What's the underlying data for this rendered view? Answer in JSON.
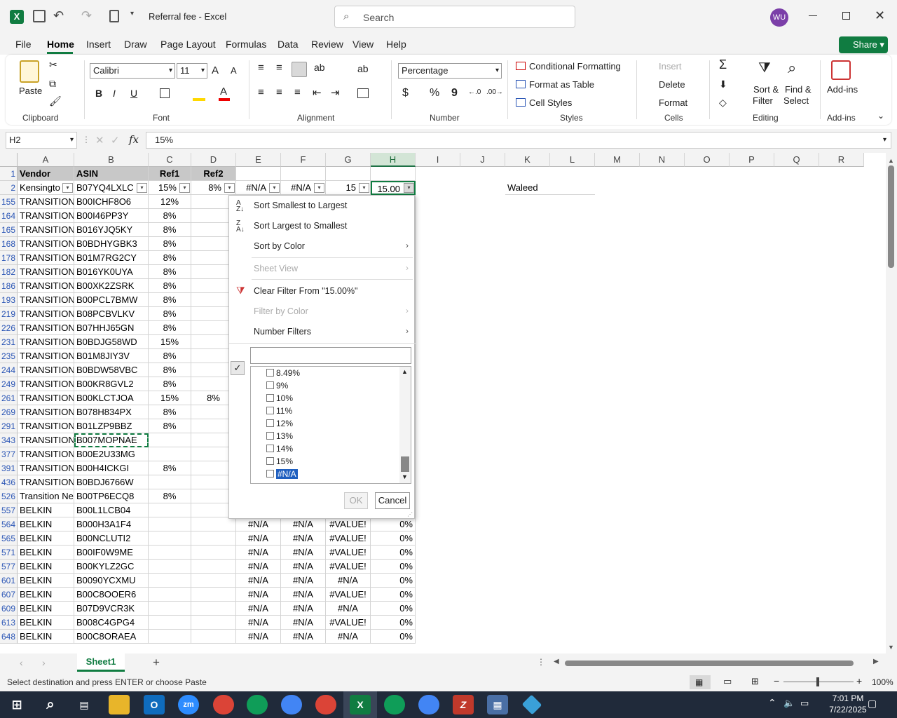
{
  "window": {
    "title": "Referral fee  -  Excel",
    "search_placeholder": "Search",
    "user_initials": "WU"
  },
  "menu": [
    "File",
    "Home",
    "Insert",
    "Draw",
    "Page Layout",
    "Formulas",
    "Data",
    "Review",
    "View",
    "Help"
  ],
  "share_label": "Share",
  "ribbon": {
    "clipboard": {
      "paste": "Paste",
      "label": "Clipboard"
    },
    "font": {
      "name": "Calibri",
      "size": "11",
      "bold": "B",
      "italic": "I",
      "underline": "U",
      "label": "Font"
    },
    "alignment": {
      "label": "Alignment"
    },
    "number": {
      "format": "Percentage",
      "currency": "$",
      "percent": "%",
      "comma": "9",
      "label": "Number"
    },
    "styles": {
      "conditional": "Conditional Formatting",
      "table": "Format as Table",
      "cell_styles": "Cell Styles",
      "label": "Styles"
    },
    "cells": {
      "insert": "Insert",
      "delete": "Delete",
      "format": "Format",
      "label": "Cells"
    },
    "editing": {
      "sum": "Σ",
      "sort": "Sort &",
      "sort2": "Filter",
      "find": "Find &",
      "find2": "Select",
      "label": "Editing"
    },
    "addins": {
      "btn": "Add-ins",
      "label": "Add-ins"
    }
  },
  "formula_bar": {
    "name_box": "H2",
    "fx": "fx",
    "value": "15%"
  },
  "columns": [
    "A",
    "B",
    "C",
    "D",
    "E",
    "F",
    "G",
    "H",
    "I",
    "J",
    "K",
    "L",
    "M",
    "N",
    "O",
    "P",
    "Q",
    "R"
  ],
  "header_row": {
    "num": "1",
    "a": "Vendor",
    "b": "ASIN",
    "c": "Ref1",
    "d": "Ref2"
  },
  "row2": {
    "num": "2",
    "a": "Kensingto",
    "b": "B07YQ4LXLC",
    "c": "15%",
    "d": "8%",
    "e": "#N/A",
    "f": "#N/A",
    "g": "15",
    "h": "15.00",
    "k": "Waleed"
  },
  "rows": [
    {
      "n": "155",
      "a": "TRANSITION",
      "b": "B00ICHF8O6",
      "c": "12%",
      "d": "",
      "e": "",
      "f": "",
      "g": "",
      "h": ""
    },
    {
      "n": "164",
      "a": "TRANSITION",
      "b": "B00I46PP3Y",
      "c": "8%",
      "d": "",
      "e": "",
      "f": "",
      "g": "",
      "h": ""
    },
    {
      "n": "165",
      "a": "TRANSITION",
      "b": "B016YJQ5KY",
      "c": "8%",
      "d": "",
      "e": "",
      "f": "",
      "g": "",
      "h": ""
    },
    {
      "n": "168",
      "a": "TRANSITION",
      "b": "B0BDHYGBK3",
      "c": "8%",
      "d": "",
      "e": "",
      "f": "",
      "g": "",
      "h": ""
    },
    {
      "n": "178",
      "a": "TRANSITION",
      "b": "B01M7RG2CY",
      "c": "8%",
      "d": "",
      "e": "",
      "f": "",
      "g": "",
      "h": ""
    },
    {
      "n": "182",
      "a": "TRANSITION",
      "b": "B016YK0UYA",
      "c": "8%",
      "d": "",
      "e": "",
      "f": "",
      "g": "",
      "h": ""
    },
    {
      "n": "186",
      "a": "TRANSITION",
      "b": "B00XK2ZSRK",
      "c": "8%",
      "d": "",
      "e": "",
      "f": "",
      "g": "",
      "h": ""
    },
    {
      "n": "193",
      "a": "TRANSITION",
      "b": "B00PCL7BMW",
      "c": "8%",
      "d": "",
      "e": "",
      "f": "",
      "g": "",
      "h": ""
    },
    {
      "n": "219",
      "a": "TRANSITION",
      "b": "B08PCBVLKV",
      "c": "8%",
      "d": "",
      "e": "",
      "f": "",
      "g": "",
      "h": ""
    },
    {
      "n": "226",
      "a": "TRANSITION",
      "b": "B07HHJ65GN",
      "c": "8%",
      "d": "",
      "e": "",
      "f": "",
      "g": "",
      "h": ""
    },
    {
      "n": "231",
      "a": "TRANSITION",
      "b": "B0BDJG58WD",
      "c": "15%",
      "d": "",
      "e": "",
      "f": "",
      "g": "",
      "h": ""
    },
    {
      "n": "235",
      "a": "TRANSITION",
      "b": "B01M8JIY3V",
      "c": "8%",
      "d": "",
      "e": "",
      "f": "",
      "g": "",
      "h": ""
    },
    {
      "n": "244",
      "a": "TRANSITION",
      "b": "B0BDW58VBC",
      "c": "8%",
      "d": "",
      "e": "",
      "f": "",
      "g": "",
      "h": ""
    },
    {
      "n": "249",
      "a": "TRANSITION",
      "b": "B00KR8GVL2",
      "c": "8%",
      "d": "",
      "e": "",
      "f": "",
      "g": "",
      "h": ""
    },
    {
      "n": "261",
      "a": "TRANSITION",
      "b": "B00KLCTJOA",
      "c": "15%",
      "d": "8%",
      "e": "",
      "f": "",
      "g": "",
      "h": ""
    },
    {
      "n": "269",
      "a": "TRANSITION",
      "b": "B078H834PX",
      "c": "8%",
      "d": "",
      "e": "",
      "f": "",
      "g": "",
      "h": ""
    },
    {
      "n": "291",
      "a": "TRANSITION",
      "b": "B01LZP9BBZ",
      "c": "8%",
      "d": "",
      "e": "",
      "f": "",
      "g": "",
      "h": ""
    },
    {
      "n": "343",
      "a": "TRANSITION",
      "b": "B007MOPNAE",
      "c": "",
      "d": "",
      "e": "",
      "f": "",
      "g": "",
      "h": ""
    },
    {
      "n": "377",
      "a": "TRANSITION",
      "b": "B00E2U33MG",
      "c": "",
      "d": "",
      "e": "",
      "f": "",
      "g": "",
      "h": ""
    },
    {
      "n": "391",
      "a": "TRANSITION",
      "b": "B00H4ICKGI",
      "c": "8%",
      "d": "",
      "e": "",
      "f": "",
      "g": "",
      "h": ""
    },
    {
      "n": "436",
      "a": "TRANSITION",
      "b": "B0BDJ6766W",
      "c": "",
      "d": "",
      "e": "",
      "f": "",
      "g": "",
      "h": ""
    },
    {
      "n": "526",
      "a": "Transition Ne",
      "b": "B00TP6ECQ8",
      "c": "8%",
      "d": "",
      "e": "",
      "f": "",
      "g": "",
      "h": ""
    },
    {
      "n": "557",
      "a": "BELKIN",
      "b": "B00L1LCB04",
      "c": "",
      "d": "",
      "e": "",
      "f": "",
      "g": "",
      "h": ""
    },
    {
      "n": "564",
      "a": "BELKIN",
      "b": "B000H3A1F4",
      "c": "",
      "d": "",
      "e": "#N/A",
      "f": "#N/A",
      "g": "#VALUE!",
      "h": "0%"
    },
    {
      "n": "565",
      "a": "BELKIN",
      "b": "B00NCLUTI2",
      "c": "",
      "d": "",
      "e": "#N/A",
      "f": "#N/A",
      "g": "#VALUE!",
      "h": "0%"
    },
    {
      "n": "571",
      "a": "BELKIN",
      "b": "B00IF0W9ME",
      "c": "",
      "d": "",
      "e": "#N/A",
      "f": "#N/A",
      "g": "#VALUE!",
      "h": "0%"
    },
    {
      "n": "577",
      "a": "BELKIN",
      "b": "B00KYLZ2GC",
      "c": "",
      "d": "",
      "e": "#N/A",
      "f": "#N/A",
      "g": "#VALUE!",
      "h": "0%"
    },
    {
      "n": "601",
      "a": "BELKIN",
      "b": "B0090YCXMU",
      "c": "",
      "d": "",
      "e": "#N/A",
      "f": "#N/A",
      "g": "#N/A",
      "h": "0%"
    },
    {
      "n": "607",
      "a": "BELKIN",
      "b": "B00C8OOER6",
      "c": "",
      "d": "",
      "e": "#N/A",
      "f": "#N/A",
      "g": "#VALUE!",
      "h": "0%"
    },
    {
      "n": "609",
      "a": "BELKIN",
      "b": "B07D9VCR3K",
      "c": "",
      "d": "",
      "e": "#N/A",
      "f": "#N/A",
      "g": "#N/A",
      "h": "0%"
    },
    {
      "n": "613",
      "a": "BELKIN",
      "b": "B008C4GPG4",
      "c": "",
      "d": "",
      "e": "#N/A",
      "f": "#N/A",
      "g": "#VALUE!",
      "h": "0%"
    },
    {
      "n": "648",
      "a": "BELKIN",
      "b": "B00C8ORAEA",
      "c": "",
      "d": "",
      "e": "#N/A",
      "f": "#N/A",
      "g": "#N/A",
      "h": "0%"
    }
  ],
  "filter_menu": {
    "sort_asc": "Sort Smallest to Largest",
    "sort_desc": "Sort Largest to Smallest",
    "sort_color": "Sort by Color",
    "sheet_view": "Sheet View",
    "clear": "Clear Filter From \"15.00%\"",
    "filter_color": "Filter by Color",
    "number_filters": "Number Filters",
    "list": [
      "8.49%",
      "9%",
      "10%",
      "11%",
      "12%",
      "13%",
      "14%",
      "15%",
      "#N/A"
    ],
    "ok": "OK",
    "cancel": "Cancel"
  },
  "sheet_tab": "Sheet1",
  "status": {
    "message": "Select destination and press ENTER or choose Paste",
    "zoom": "100%"
  },
  "taskbar": {
    "time": "7:01 PM",
    "date": "7/22/2025"
  }
}
